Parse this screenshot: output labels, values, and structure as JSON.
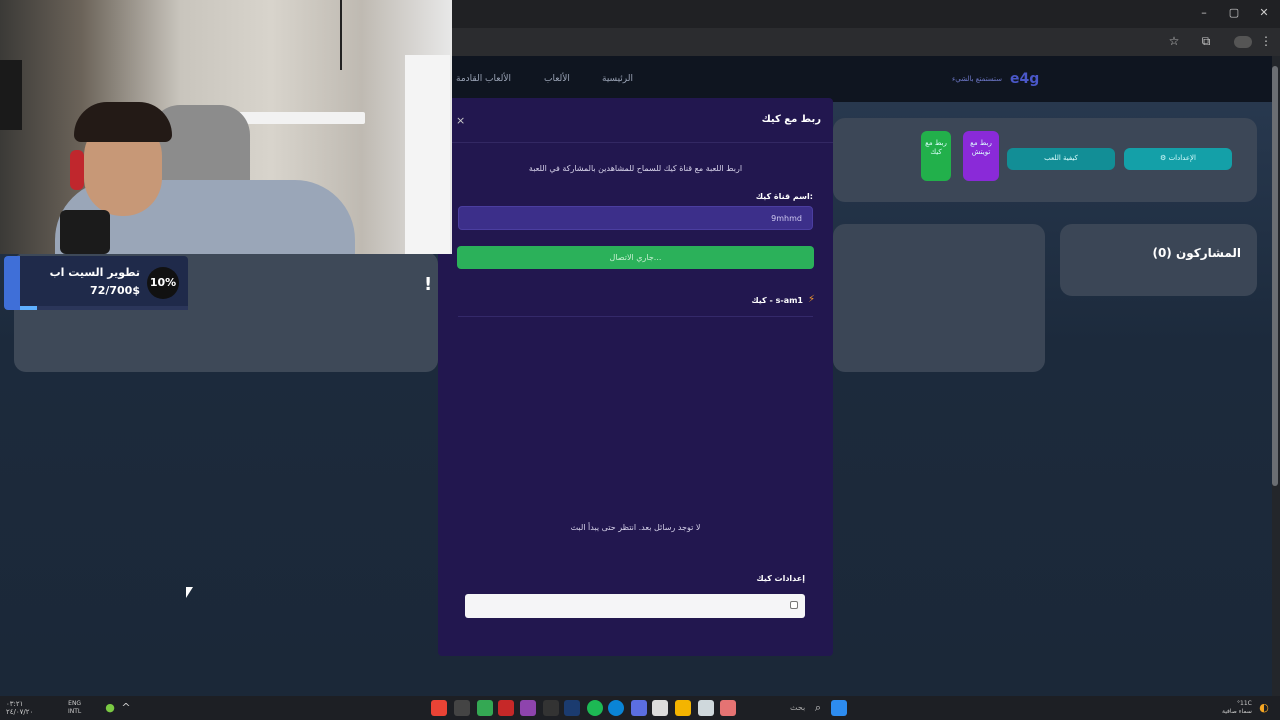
{
  "browser": {
    "controls": {
      "minimize": "–",
      "maximize": "▢",
      "close": "✕"
    }
  },
  "site": {
    "logo": "e4g",
    "logo_tag": "ستستمتع بالشيء",
    "nav": [
      "الرئيسية",
      "الألعاب",
      "الألعاب القادمة"
    ]
  },
  "dashboard": {
    "settings_btn": "⚙ الإعدادات",
    "howto_btn": "كيفية اللعب",
    "twitch_btn": "ربط مع تويتش",
    "kick_btn": "ربط مع كيك",
    "participants_title": "المشاركون (0)",
    "exclaim": "!"
  },
  "modal": {
    "title": "ربط مع كيك",
    "close": "×",
    "description": "اربط اللعبة مع قناة كيك للسماح للمشاهدين بالمشاركة في اللعبة",
    "channel_label": "اسم قناة كيك:",
    "channel_value": "9mhmd",
    "connect_button": "جاري الاتصال...",
    "chat_header": "كيك - s-am1",
    "empty_message": "لا توجد رسائل بعد. انتظر حتى يبدأ البث",
    "kick_settings_label": "إعدادات كيك",
    "settings_input_value": ""
  },
  "goal": {
    "title": "تطوير السيت اب",
    "progress_text": "72/700$",
    "percent_label": "10%",
    "fraction": 0.103
  },
  "taskbar": {
    "clock": "٠٣:٢١\n٢٤/٠٧/٢٠",
    "lang": "ENG\nINTL",
    "search": "بحث",
    "weather": "°11C\nسماء صافية"
  },
  "icons": {
    "bolt": "bolt-icon",
    "close": "close-icon",
    "star": "star-icon",
    "extensions": "puzzle-icon",
    "menu": "kebab-menu-icon"
  }
}
